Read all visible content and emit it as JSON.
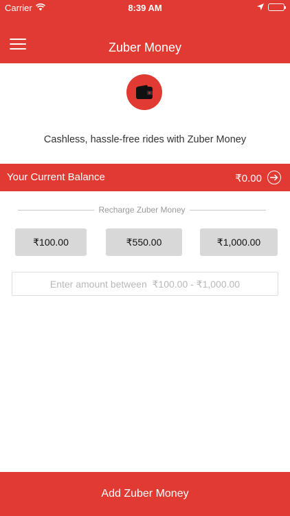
{
  "status_bar": {
    "carrier": "Carrier",
    "time": "8:39 AM"
  },
  "nav": {
    "title": "Zuber Money",
    "menu_icon": "hamburger-menu-icon"
  },
  "hero": {
    "icon": "wallet-icon",
    "tagline": "Cashless, hassle-free rides with Zuber Money"
  },
  "balance": {
    "label": "Your Current Balance",
    "amount": "₹0.00",
    "arrow_icon": "arrow-right-circle-icon"
  },
  "recharge": {
    "heading": "Recharge Zuber Money",
    "options": [
      "₹100.00",
      "₹550.00",
      "₹1,000.00"
    ],
    "input_placeholder": "Enter amount between  ₹100.00 - ₹1,000.00",
    "input_value": ""
  },
  "footer": {
    "button_label": "Add Zuber Money"
  },
  "colors": {
    "brand": "#e03a33",
    "chip": "#d8d8d8"
  }
}
